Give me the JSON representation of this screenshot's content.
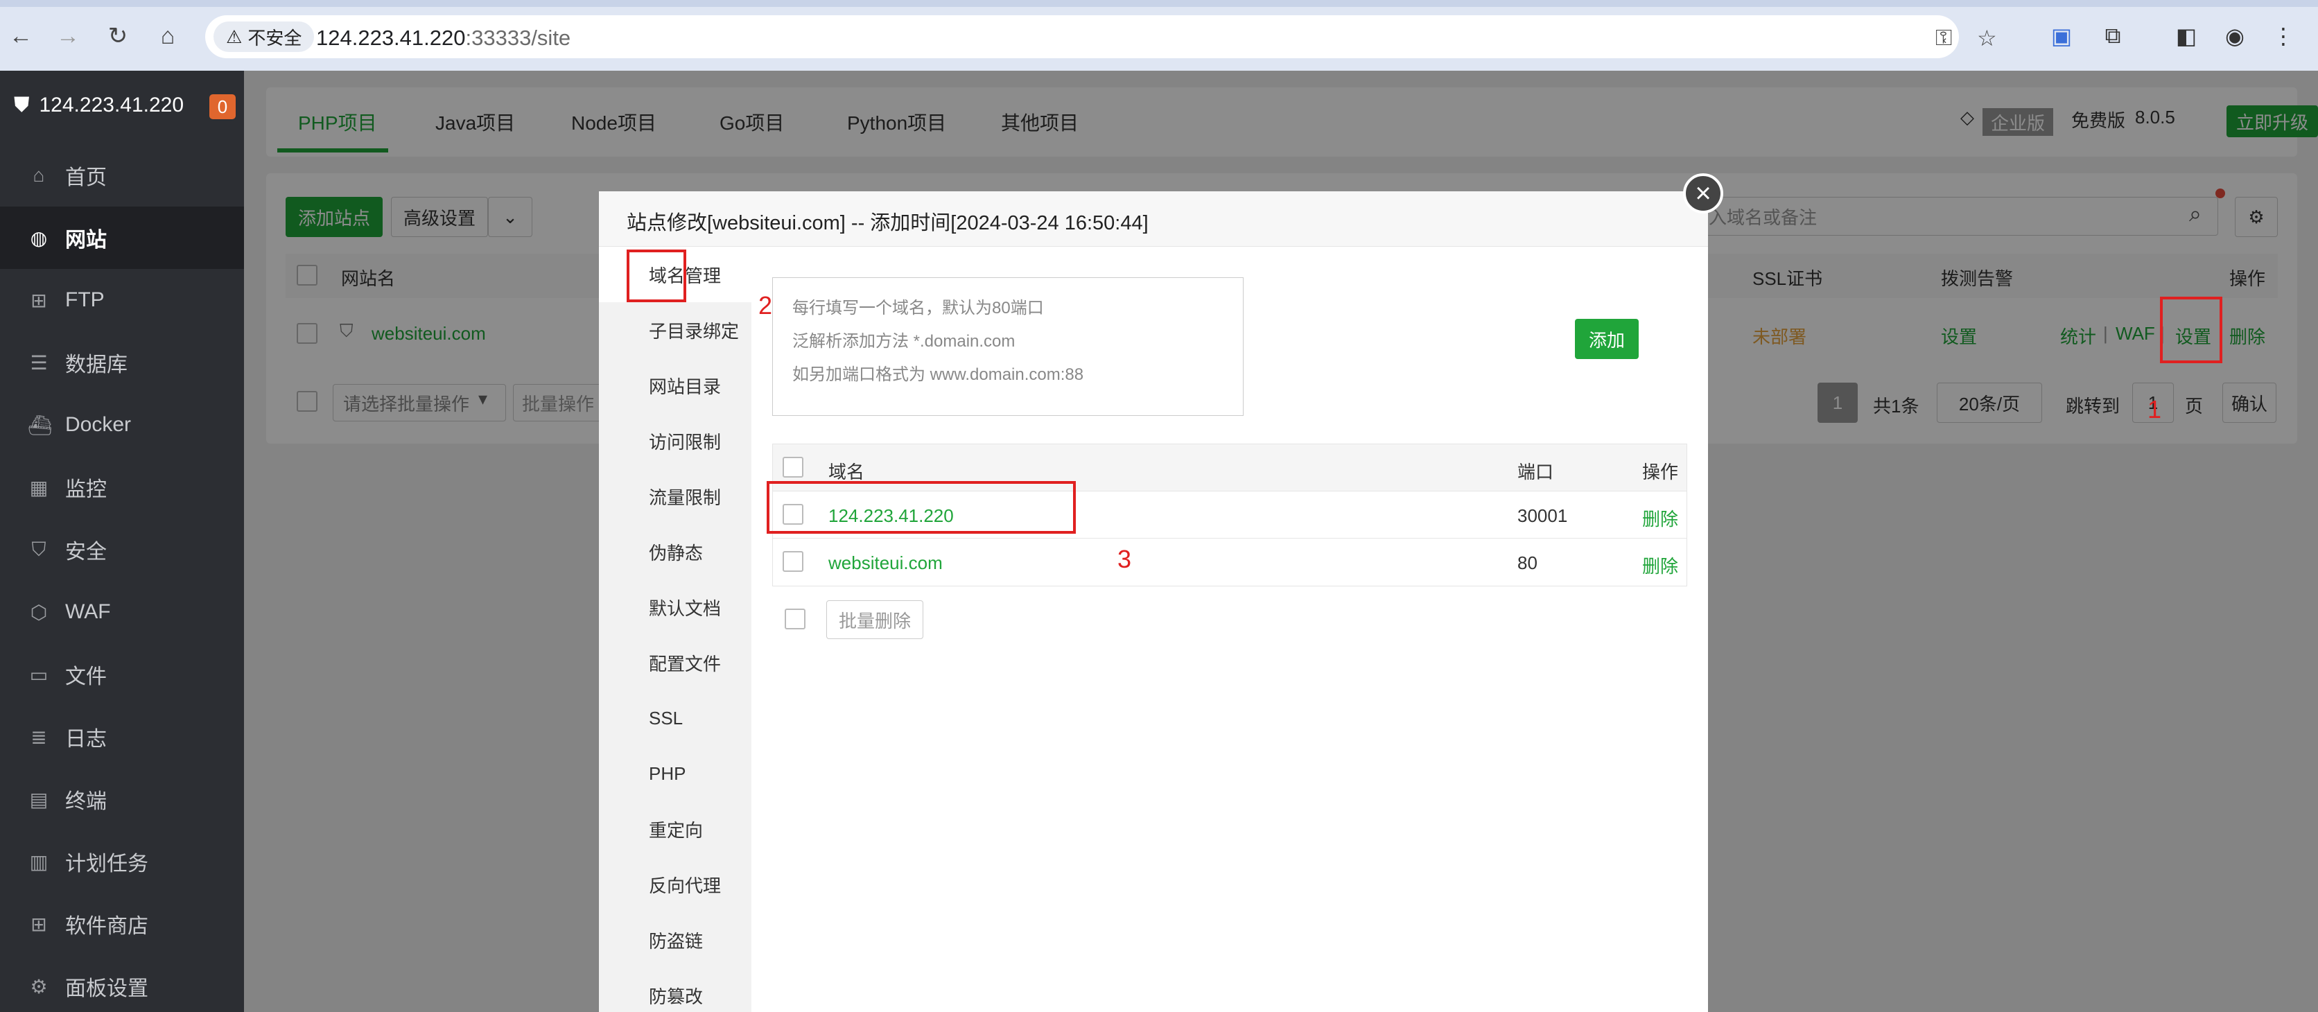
{
  "browser": {
    "insecure_label": "不安全",
    "url_host": "124.223.41.220",
    "url_rest": ":33333/site"
  },
  "sidebar": {
    "server_ip": "124.223.41.220",
    "badge": "0",
    "items": [
      {
        "label": "首页",
        "icon": "home-icon"
      },
      {
        "label": "网站",
        "icon": "globe-icon"
      },
      {
        "label": "FTP",
        "icon": "ftp-icon"
      },
      {
        "label": "数据库",
        "icon": "database-icon"
      },
      {
        "label": "Docker",
        "icon": "docker-icon"
      },
      {
        "label": "监控",
        "icon": "monitor-icon"
      },
      {
        "label": "安全",
        "icon": "shield-icon"
      },
      {
        "label": "WAF",
        "icon": "waf-icon"
      },
      {
        "label": "文件",
        "icon": "folder-icon"
      },
      {
        "label": "日志",
        "icon": "log-icon"
      },
      {
        "label": "终端",
        "icon": "terminal-icon"
      },
      {
        "label": "计划任务",
        "icon": "calendar-icon"
      },
      {
        "label": "软件商店",
        "icon": "apps-icon"
      },
      {
        "label": "面板设置",
        "icon": "gear-icon"
      }
    ]
  },
  "main": {
    "tabs": [
      "PHP项目",
      "Java项目",
      "Node项目",
      "Go项目",
      "Python项目",
      "其他项目"
    ],
    "edition_tag": "企业版",
    "free_label": "免费版",
    "version": "8.0.5",
    "upgrade": "立即升级",
    "add_site": "添加站点",
    "advanced": "高级设置",
    "search_placeholder": "入域名或备注",
    "col_site": "网站名",
    "col_ssl": "SSL证书",
    "col_alarm": "拨测告警",
    "col_ops": "操作",
    "site_name": "websiteui.com",
    "ssl_status": "未部署",
    "alarm_setting": "设置",
    "op_stats": "统计",
    "op_waf": "WAF",
    "op_settings": "设置",
    "op_delete": "删除",
    "sep": "|",
    "batch_placeholder": "请选择批量操作",
    "batch_btn": "批量操作",
    "page_current": "1",
    "total": "共1条",
    "per_page": "20条/页",
    "goto": "跳转到",
    "goto_page": "1",
    "page_unit": "页",
    "confirm": "确认"
  },
  "modal": {
    "title": "站点修改[websiteui.com] -- 添加时间[2024-03-24 16:50:44]",
    "nav": [
      "域名管理",
      "子目录绑定",
      "网站目录",
      "访问限制",
      "流量限制",
      "伪静态",
      "默认文档",
      "配置文件",
      "SSL",
      "PHP",
      "重定向",
      "反向代理",
      "防盗链",
      "防篡改"
    ],
    "textarea_lines": [
      "每行填写一个域名，默认为80端口",
      "泛解析添加方法 *.domain.com",
      "如另加端口格式为 www.domain.com:88"
    ],
    "add_btn": "添加",
    "col_domain": "域名",
    "col_port": "端口",
    "col_ops": "操作",
    "rows": [
      {
        "domain": "124.223.41.220",
        "port": "30001",
        "op": "删除"
      },
      {
        "domain": "websiteui.com",
        "port": "80",
        "op": "删除"
      }
    ],
    "batch_delete": "批量删除"
  },
  "annotations": {
    "a1": "1",
    "a2": "2",
    "a3": "3"
  },
  "colors": {
    "accent": "#20a53a",
    "annotation": "#e02020",
    "sidebar": "#2c2e33"
  }
}
